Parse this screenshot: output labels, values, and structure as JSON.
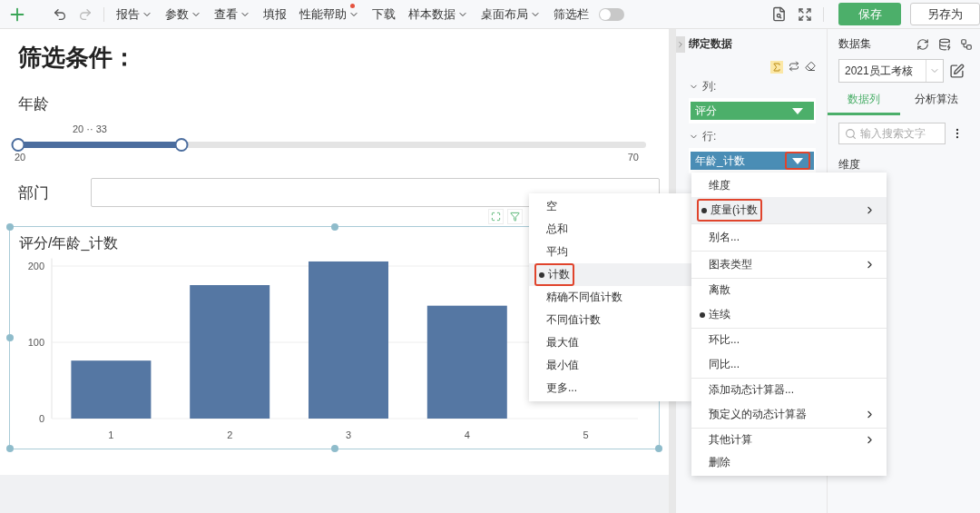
{
  "toolbar": {
    "items": [
      {
        "label": "报告",
        "dropdown": true,
        "badge": false
      },
      {
        "label": "参数",
        "dropdown": true,
        "badge": false
      },
      {
        "label": "查看",
        "dropdown": true,
        "badge": false
      },
      {
        "label": "填报",
        "dropdown": false,
        "badge": false
      },
      {
        "label": "性能帮助",
        "dropdown": true,
        "badge": true
      },
      {
        "label": "下载",
        "dropdown": false,
        "badge": false
      },
      {
        "label": "样本数据",
        "dropdown": true,
        "badge": false
      },
      {
        "label": "桌面布局",
        "dropdown": true,
        "badge": false
      }
    ],
    "filter_bar": {
      "label": "筛选栏",
      "on": false
    },
    "buttons": [
      {
        "label": "保存",
        "primary": true
      },
      {
        "label": "另存为",
        "primary": false
      }
    ]
  },
  "filters": {
    "title": "筛选条件：",
    "age": {
      "label": "年龄",
      "range_text": "20 ·· 33",
      "min": "20",
      "max": "70",
      "level": 0.26
    },
    "department": {
      "label": "部门"
    }
  },
  "chart": {
    "title": "评分/年龄_计数",
    "chart_data": {
      "type": "bar",
      "categories": [
        "1",
        "2",
        "3",
        "4",
        "5"
      ],
      "values": [
        76,
        175,
        206,
        148,
        null
      ],
      "yticks": [
        0,
        100,
        200
      ],
      "ylim": [
        0,
        210
      ]
    }
  },
  "bind_panel": {
    "title": "绑定数据",
    "columns": {
      "label": "列:",
      "field": "评分",
      "circled": false
    },
    "rows": {
      "label": "行:",
      "field": "年龄_计数",
      "circled": true
    }
  },
  "data_panel": {
    "title": "数据集",
    "dataset": "2021员工考核",
    "tabs": [
      {
        "label": "数据列",
        "selected": true
      },
      {
        "label": "分析算法",
        "selected": false
      }
    ],
    "search_placeholder": "输入搜索文字",
    "section": "维度"
  },
  "field_menu": {
    "items": [
      {
        "label": "维度",
        "selected": false,
        "hovered": false,
        "submenu": false,
        "divider_after": false
      },
      {
        "label": "度量(计数",
        "selected": true,
        "hovered": true,
        "submenu": true,
        "divider_after": true
      },
      {
        "label": "别名...",
        "selected": false,
        "hovered": false,
        "submenu": false,
        "divider_after": true
      },
      {
        "label": "图表类型",
        "selected": false,
        "hovered": false,
        "submenu": true,
        "divider_after": true
      },
      {
        "label": "离散",
        "selected": false,
        "hovered": false,
        "submenu": false,
        "divider_after": false
      },
      {
        "label": "连续",
        "selected": true,
        "hovered": false,
        "submenu": false,
        "divider_after": true
      },
      {
        "label": "环比...",
        "selected": false,
        "hovered": false,
        "submenu": false,
        "divider_after": false
      },
      {
        "label": "同比...",
        "selected": false,
        "hovered": false,
        "submenu": false,
        "divider_after": true
      },
      {
        "label": "添加动态计算器...",
        "selected": false,
        "hovered": false,
        "submenu": false,
        "divider_after": false
      },
      {
        "label": "预定义的动态计算器",
        "selected": false,
        "hovered": false,
        "submenu": true,
        "divider_after": true
      },
      {
        "label": "其他计算",
        "selected": false,
        "hovered": false,
        "submenu": true,
        "divider_after": false
      },
      {
        "label": "删除",
        "selected": false,
        "hovered": false,
        "submenu": false,
        "divider_after": false
      }
    ]
  },
  "aggregate_menu": {
    "items": [
      {
        "label": "空",
        "selected": false,
        "hovered": false
      },
      {
        "label": "总和",
        "selected": false,
        "hovered": false
      },
      {
        "label": "平均",
        "selected": false,
        "hovered": false
      },
      {
        "label": "计数",
        "selected": true,
        "hovered": true
      },
      {
        "label": "精确不同值计数",
        "selected": false,
        "hovered": false
      },
      {
        "label": "不同值计数",
        "selected": false,
        "hovered": false
      },
      {
        "label": "最大值",
        "selected": false,
        "hovered": false
      },
      {
        "label": "最小值",
        "selected": false,
        "hovered": false
      },
      {
        "label": "更多...",
        "selected": false,
        "hovered": false
      }
    ]
  }
}
